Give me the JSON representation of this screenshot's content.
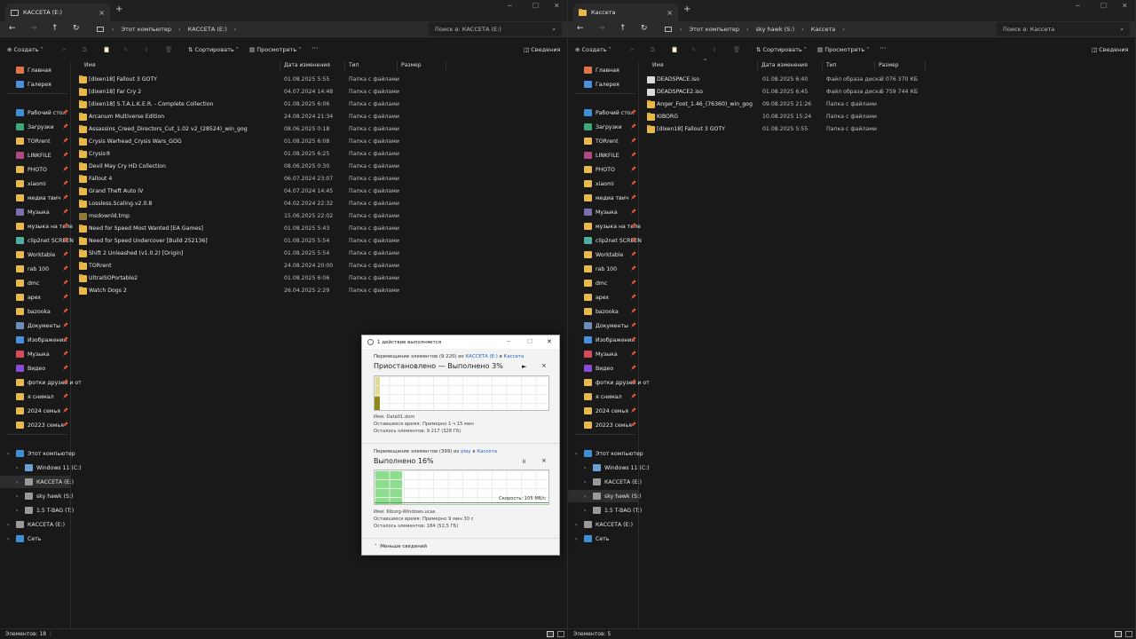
{
  "left": {
    "tab_title": "КАССЕТА (E:)",
    "breadcrumb": [
      "Этот компьютер",
      "КАССЕТА (E:)"
    ],
    "search_placeholder": "Поиск в: КАССЕТА (E:)",
    "toolbar": {
      "create": "Создать",
      "sort": "Сортировать",
      "view": "Просмотреть",
      "more": "···",
      "details": "Сведения"
    },
    "columns": {
      "name": "Имя",
      "date": "Дата изменения",
      "type": "Тип",
      "size": "Размер"
    },
    "files": [
      {
        "name": "[dixen18] Fallout 3 GOTY",
        "date": "01.08.2025 5:55",
        "type": "Папка с файлами",
        "icon": "folder"
      },
      {
        "name": "[dixen18] Far Cry 2",
        "date": "04.07.2024 14:48",
        "type": "Папка с файлами",
        "icon": "folder"
      },
      {
        "name": "[dixen18] S.T.A.L.K.E.R. - Complete Collection",
        "date": "01.08.2025 6:06",
        "type": "Папка с файлами",
        "icon": "folder"
      },
      {
        "name": "Arcanum Multiverse Edition",
        "date": "24.08.2024 21:34",
        "type": "Папка с файлами",
        "icon": "folder"
      },
      {
        "name": "Assassins_Creed_Directors_Cut_1.02 v2_(28524)_win_gog",
        "date": "08.06.2025 0:18",
        "type": "Папка с файлами",
        "icon": "folder"
      },
      {
        "name": "Crysis Warhead_Crysis Wars_GOG",
        "date": "01.08.2025 6:08",
        "type": "Папка с файлами",
        "icon": "folder"
      },
      {
        "name": "Crysis®",
        "date": "01.08.2025 6:25",
        "type": "Папка с файлами",
        "icon": "folder"
      },
      {
        "name": "Devil May Cry HD Collection",
        "date": "08.06.2025 0:30",
        "type": "Папка с файлами",
        "icon": "folder"
      },
      {
        "name": "Fallout 4",
        "date": "06.07.2024 23:07",
        "type": "Папка с файлами",
        "icon": "folder"
      },
      {
        "name": "Grand Theft Auto IV",
        "date": "04.07.2024 14:45",
        "type": "Папка с файлами",
        "icon": "folder"
      },
      {
        "name": "Lossless.Scaling.v2.0.8",
        "date": "04.02.2024 22:32",
        "type": "Папка с файлами",
        "icon": "folder"
      },
      {
        "name": "msdownld.tmp",
        "date": "15.06.2025 22:02",
        "type": "Папка с файлами",
        "icon": "tmp"
      },
      {
        "name": "Need for Speed Most Wanted [EA Games]",
        "date": "01.08.2025 5:43",
        "type": "Папка с файлами",
        "icon": "folder"
      },
      {
        "name": "Need for Speed Undercover [Build 252136]",
        "date": "01.08.2025 5:54",
        "type": "Папка с файлами",
        "icon": "folder"
      },
      {
        "name": "Shift 2 Unleashed (v1.0.2) [Origin]",
        "date": "01.08.2025 5:54",
        "type": "Папка с файлами",
        "icon": "folder"
      },
      {
        "name": "TORrent",
        "date": "24.08.2024 20:00",
        "type": "Папка с файлами",
        "icon": "folder"
      },
      {
        "name": "UltraISOPortable2",
        "date": "01.08.2025 6:06",
        "type": "Папка с файлами",
        "icon": "folder"
      },
      {
        "name": "Watch Dogs 2",
        "date": "26.04.2025 2:29",
        "type": "Папка с файлами",
        "icon": "folder"
      }
    ],
    "status": "Элементов: 18"
  },
  "right": {
    "tab_title": "Кассета",
    "breadcrumb": [
      "Этот компьютер",
      "sky hawk (S:)",
      "Кассета"
    ],
    "search_placeholder": "Поиск в: Кассета",
    "toolbar": {
      "create": "Создать",
      "sort": "Сортировать",
      "view": "Просмотреть",
      "more": "···",
      "details": "Сведения"
    },
    "columns": {
      "name": "Имя",
      "date": "Дата изменения",
      "type": "Тип",
      "size": "Размер"
    },
    "files": [
      {
        "name": "DEADSPACE.iso",
        "date": "01.08.2025 6:40",
        "type": "Файл образа диска",
        "size": "3 076 370 КБ",
        "icon": "iso"
      },
      {
        "name": "DEADSPACE2.iso",
        "date": "01.08.2025 6:45",
        "type": "Файл образа диска",
        "size": "5 759 744 КБ",
        "icon": "iso"
      },
      {
        "name": "Anger_Foot_1.46_(76360)_win_gog",
        "date": "09.08.2025 21:26",
        "type": "Папка с файлами",
        "size": "",
        "icon": "folder"
      },
      {
        "name": "KIBORG",
        "date": "10.08.2025 15:24",
        "type": "Папка с файлами",
        "size": "",
        "icon": "folder"
      },
      {
        "name": "[dixen18] Fallout 3 GOTY",
        "date": "01.08.2025 5:55",
        "type": "Папка с файлами",
        "size": "",
        "icon": "folder"
      }
    ],
    "status": "Элементов: 5"
  },
  "sidebar": {
    "top": [
      {
        "label": "Главная",
        "icon": "home-icon",
        "color": "#e0734a"
      },
      {
        "label": "Галерея",
        "icon": "gallery-icon",
        "color": "#4a8fe0"
      }
    ],
    "pinned": [
      {
        "label": "Рабочий стол",
        "icon": "desktop-icon",
        "color": "#3d8fd6"
      },
      {
        "label": "Загрузки",
        "icon": "downloads-icon",
        "color": "#3aa67a"
      },
      {
        "label": "TORrent",
        "icon": "folder-icon",
        "color": "#e8b84a"
      },
      {
        "label": "LINKFILE",
        "icon": "image-icon",
        "color": "#b0487f"
      },
      {
        "label": "PHOTO",
        "icon": "folder-icon",
        "color": "#e8b84a"
      },
      {
        "label": "xiaomi",
        "icon": "folder-icon",
        "color": "#e8b84a"
      },
      {
        "label": "медиа твич",
        "icon": "folder-icon",
        "color": "#e8b84a"
      },
      {
        "label": "Музыка",
        "icon": "image-icon",
        "color": "#7a6fb0"
      },
      {
        "label": "музыка на теле",
        "icon": "folder-icon",
        "color": "#e8b84a"
      },
      {
        "label": "clip2net SCREEN",
        "icon": "image-icon",
        "color": "#4ab0a0"
      },
      {
        "label": "Worktable",
        "icon": "folder-icon",
        "color": "#e8b84a"
      },
      {
        "label": "rab 100",
        "icon": "folder-icon",
        "color": "#e8b84a"
      },
      {
        "label": "dmc",
        "icon": "folder-icon",
        "color": "#e8b84a"
      },
      {
        "label": "apex",
        "icon": "folder-icon",
        "color": "#e8b84a"
      },
      {
        "label": "bazooka",
        "icon": "folder-icon",
        "color": "#e8b84a"
      },
      {
        "label": "Документы",
        "icon": "documents-icon",
        "color": "#6b8fb8"
      },
      {
        "label": "Изображения",
        "icon": "pictures-icon",
        "color": "#4a8fe0"
      },
      {
        "label": "Музыка",
        "icon": "music-icon",
        "color": "#d84a5a"
      },
      {
        "label": "Видео",
        "icon": "video-icon",
        "color": "#8a4ad8"
      },
      {
        "label": "фотки друзей и от",
        "icon": "folder-icon",
        "color": "#e8b84a"
      },
      {
        "label": "я снимал",
        "icon": "folder-icon",
        "color": "#e8b84a"
      },
      {
        "label": "2024 семья",
        "icon": "folder-icon",
        "color": "#e8b84a"
      },
      {
        "label": "20223 семья",
        "icon": "folder-icon",
        "color": "#e8b84a"
      }
    ],
    "tree": [
      {
        "label": "Этот компьютер",
        "icon": "pc-icon",
        "color": "#3d8fd6",
        "level": 0
      },
      {
        "label": "Windows 11 (C:)",
        "icon": "drive-icon",
        "color": "#6aa0d8",
        "level": 1
      },
      {
        "label": "КАССЕТА (E:)",
        "icon": "drive-icon",
        "color": "#9a9a9a",
        "level": 1
      },
      {
        "label": "sky hawk (S:)",
        "icon": "drive-icon",
        "color": "#9a9a9a",
        "level": 1
      },
      {
        "label": "1.5 T-BAG (T:)",
        "icon": "drive-icon",
        "color": "#9a9a9a",
        "level": 1
      },
      {
        "label": "КАССЕТА (E:)",
        "icon": "drive-icon",
        "color": "#9a9a9a",
        "level": 0
      },
      {
        "label": "Сеть",
        "icon": "network-icon",
        "color": "#3d8fd6",
        "level": 0
      }
    ]
  },
  "dialog": {
    "title": "1 действие выполняется",
    "op1": {
      "prefix": "Перемещение элементов (9 220) из ",
      "src": "КАССЕТА (E:)",
      "mid": " в ",
      "dst": "Кассета",
      "status": "Приостановлено — Выполнено 3%",
      "progress": 0.03,
      "fill": "#c8bd3a",
      "name_label": "Имя:",
      "name": "Data01.dxm",
      "remain_label": "Оставшееся время:",
      "remain": "Примерно 1 ч 15 мин",
      "left_label": "Осталось элементов:",
      "left": "9 217 (328 ГБ)",
      "play_icon": "►",
      "close_icon": "×"
    },
    "op2": {
      "prefix": "Перемещение элементов (399) из ",
      "src": "play",
      "mid": " в ",
      "dst": "Кассета",
      "status": "Выполнено 16%",
      "progress": 0.16,
      "fill": "#7ad67a",
      "speed": "Скорость: 105 МБ/с",
      "name_label": "Имя:",
      "name": "Kiborg-Windows.ucas",
      "remain_label": "Оставшееся время:",
      "remain": "Примерно 9 мин 30 с",
      "left_label": "Осталось элементов:",
      "left": "184 (52,5 ГБ)",
      "pause_icon": "॥",
      "close_icon": "×"
    },
    "less": "Меньше сведений"
  }
}
